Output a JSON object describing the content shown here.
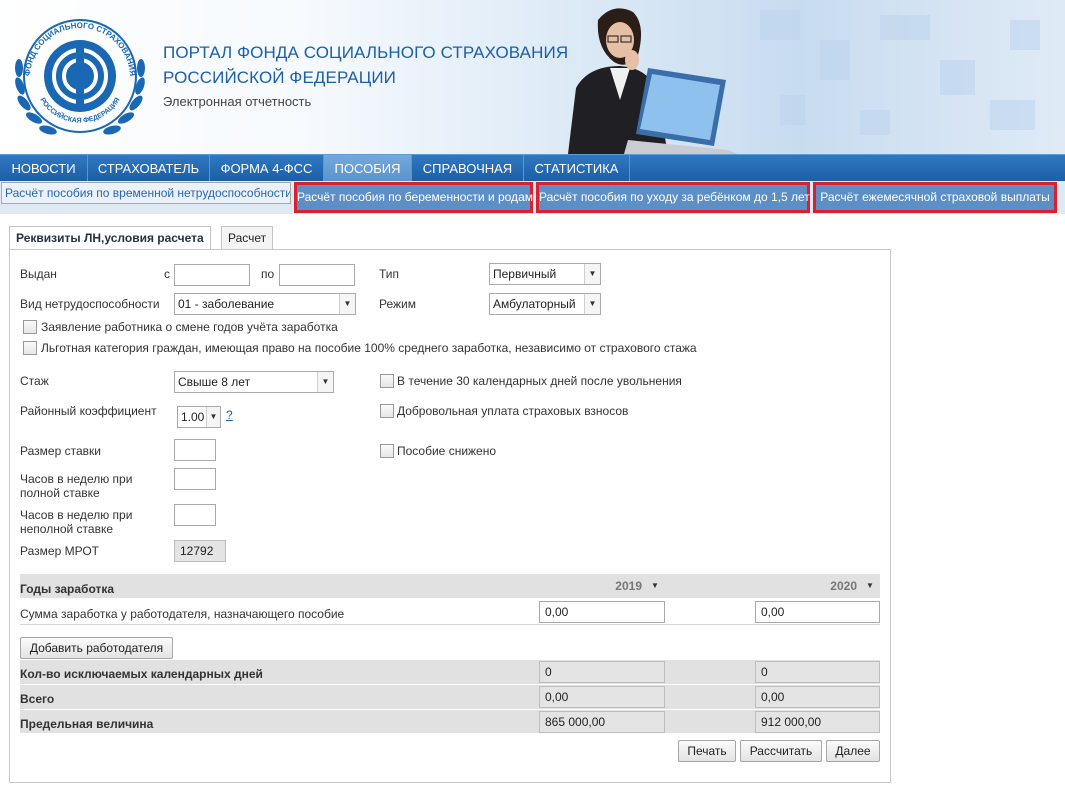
{
  "header": {
    "title_line1": "ПОРТАЛ ФОНДА СОЦИАЛЬНОГО СТРАХОВАНИЯ",
    "title_line2": "РОССИЙСКОЙ ФЕДЕРАЦИИ",
    "subtitle": "Электронная отчетность",
    "logo_text_top": "ФОНД СОЦИАЛЬНОГО СТРАХОВАНИЯ",
    "logo_text_bottom": "РОССИЙСКАЯ ФЕДЕРАЦИЯ"
  },
  "nav": {
    "items": [
      "НОВОСТИ",
      "СТРАХОВАТЕЛЬ",
      "ФОРМА 4-ФСС",
      "ПОСОБИЯ",
      "СПРАВОЧНАЯ",
      "СТАТИСТИКА"
    ],
    "active": "ПОСОБИЯ"
  },
  "subtabs": {
    "items": [
      "Расчёт пособия по временной нетрудоспособности",
      "Расчёт пособия по беременности и родам",
      "Расчёт пособия по уходу за ребёнком до 1,5 лет",
      "Расчёт ежемесячной страховой выплаты"
    ],
    "selected": "Расчёт пособия по временной нетрудоспособности"
  },
  "form_tabs": [
    "Реквизиты ЛН,условия расчета",
    "Расчет"
  ],
  "form": {
    "issued_label": "Выдан",
    "from_label": "с",
    "to_label": "по",
    "issued_from_value": "",
    "issued_to_value": "",
    "type_label": "Тип",
    "type_value": "Первичный",
    "disability_label": "Вид нетрудоспособности",
    "disability_value": "01 - заболевание",
    "mode_label": "Режим",
    "mode_value": "Амбулаторный",
    "chk_change_years": "Заявление работника о смене годов учёта заработка",
    "chk_privileged": "Льготная категория граждан, имеющая право на пособие 100% среднего заработка, независимо от страхового стажа",
    "experience_label": "Стаж",
    "experience_value": "Свыше 8 лет",
    "chk_30days": "В течение 30 календарных дней после увольнения",
    "district_label": "Районный коэффициент",
    "district_value": "1.00",
    "help_link": "?",
    "chk_voluntary": "Добровольная уплата страховых взносов",
    "rate_label": "Размер ставки",
    "rate_value": "",
    "chk_reduced": "Пособие снижено",
    "hours_full_label_1": "Часов в неделю при",
    "hours_full_label_2": "полной ставке",
    "hours_full_value": "",
    "hours_part_label_1": "Часов в неделю при",
    "hours_part_label_2": "неполной ставке",
    "hours_part_value": "",
    "mrot_label": "Размер МРОТ",
    "mrot_value": "12792"
  },
  "earnings": {
    "years_label": "Годы заработка",
    "year1": "2019",
    "year2": "2020",
    "sum_label": "Сумма заработка у работодателя, назначающего пособие",
    "sum1": "0,00",
    "sum2": "0,00",
    "add_employer_button": "Добавить работодателя",
    "excluded_days_label": "Кол-во исключаемых календарных дней",
    "excluded1": "0",
    "excluded2": "0",
    "total_label": "Всего",
    "total1": "0,00",
    "total2": "0,00",
    "limit_label": "Предельная величина",
    "limit1": "865 000,00",
    "limit2": "912 000,00"
  },
  "actions": {
    "print": "Печать",
    "calculate": "Рассчитать",
    "next": "Далее"
  },
  "colors": {
    "nav_blue": "#1b5fa8",
    "highlight_red": "#d9202e",
    "title_blue": "#1d5fa6"
  }
}
